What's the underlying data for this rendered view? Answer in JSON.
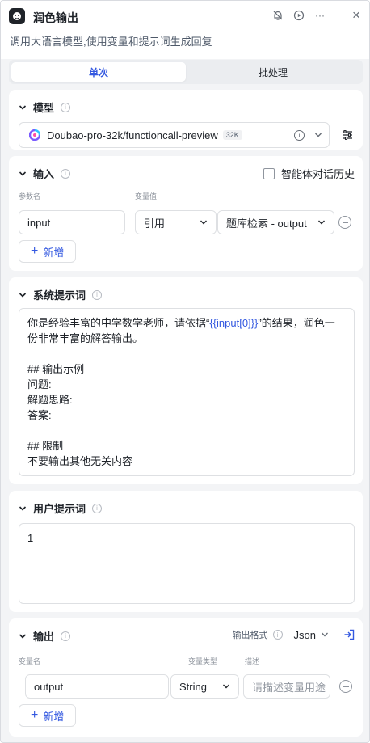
{
  "header": {
    "title": "润色输出",
    "subtitle": "调用大语言模型,使用变量和提示词生成回复",
    "more": "···",
    "close": "×"
  },
  "tabs": [
    {
      "label": "单次",
      "active": true
    },
    {
      "label": "批处理",
      "active": false
    }
  ],
  "model": {
    "title": "模型",
    "name": "Doubao-pro-32k/functioncall-preview",
    "badge": "32K"
  },
  "input": {
    "title": "输入",
    "history_label": "智能体对话历史",
    "col_param": "参数名",
    "col_value": "变量值",
    "rows": [
      {
        "name": "input",
        "type": "引用",
        "value": "题库检索 - output"
      }
    ],
    "add_label": "新增"
  },
  "system_prompt": {
    "title": "系统提示词",
    "line1_pre": "你是经验丰富的中学数学老师，请依据“",
    "line1_var": "{{input[0]}}",
    "line1_post": "”的结果，润色一",
    "lines": [
      "份非常丰富的解答输出。",
      "",
      "## 输出示例",
      "问题:",
      "解题思路:",
      "答案:",
      "",
      "## 限制",
      "不要输出其他无关内容"
    ]
  },
  "user_prompt": {
    "title": "用户提示词",
    "text": "1"
  },
  "output": {
    "title": "输出",
    "format_label": "输出格式",
    "format_value": "Json",
    "col_name": "变量名",
    "col_type": "变量类型",
    "col_desc": "描述",
    "rows": [
      {
        "name": "output",
        "type": "String",
        "desc_placeholder": "请描述变量用途"
      }
    ],
    "add_label": "新增"
  },
  "colors": {
    "accent": "#3358e0",
    "border": "#dee0e3",
    "bg": "#f3f4f6"
  }
}
